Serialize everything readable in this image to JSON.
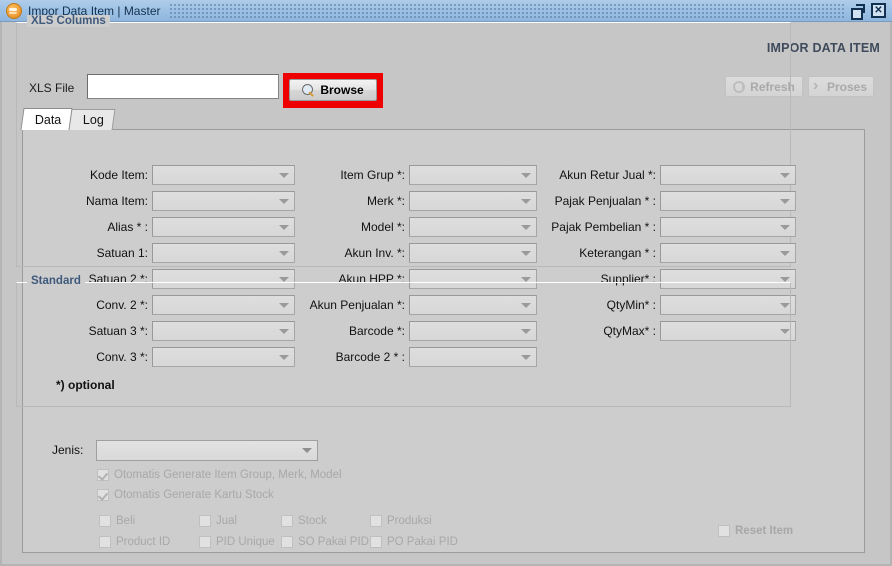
{
  "window": {
    "title": "Impor Data Item | Master",
    "app_icon": "app-logo-icon",
    "restore_label": "",
    "close_label": "✕"
  },
  "header": {
    "caption": "IMPOR DATA ITEM"
  },
  "toolbar": {
    "xls_file_label": "XLS File",
    "xls_file_value": "",
    "xls_file_placeholder": "",
    "browse_label": "Browse",
    "browse_icon": "magnifier-icon",
    "browse_highlight_color": "#ee0000",
    "refresh_label": "Refresh",
    "refresh_icon": "refresh-icon",
    "refresh_enabled": false,
    "proses_label": "Proses",
    "proses_icon": "play-icon",
    "proses_enabled": false
  },
  "tabs": [
    {
      "label": "Data",
      "active": true
    },
    {
      "label": "Log",
      "active": false
    }
  ],
  "xls_columns": {
    "title": "XLS Columns",
    "optional_note": "*) optional",
    "col1": [
      {
        "label": "Kode Item:",
        "value": ""
      },
      {
        "label": "Nama Item:",
        "value": ""
      },
      {
        "label": "Alias * :",
        "value": ""
      },
      {
        "label": "Satuan 1:",
        "value": ""
      },
      {
        "label": "Satuan 2 *:",
        "value": ""
      },
      {
        "label": "Conv. 2 *:",
        "value": ""
      },
      {
        "label": "Satuan 3 *:",
        "value": ""
      },
      {
        "label": "Conv. 3 *:",
        "value": ""
      }
    ],
    "col2": [
      {
        "label": "Item Grup *:",
        "value": ""
      },
      {
        "label": "Merk *:",
        "value": ""
      },
      {
        "label": "Model *:",
        "value": ""
      },
      {
        "label": "Akun Inv. *:",
        "value": ""
      },
      {
        "label": "Akun HPP *:",
        "value": ""
      },
      {
        "label": "Akun Penjualan *:",
        "value": ""
      },
      {
        "label": "Barcode *:",
        "value": ""
      },
      {
        "label": "Barcode 2 * :",
        "value": ""
      }
    ],
    "col3": [
      {
        "label": "Akun Retur Jual *:",
        "value": ""
      },
      {
        "label": "Pajak Penjualan * :",
        "value": ""
      },
      {
        "label": "Pajak Pembelian * :",
        "value": ""
      },
      {
        "label": "Keterangan * :",
        "value": ""
      },
      {
        "label": "Supplier* :",
        "value": ""
      },
      {
        "label": "QtyMin* :",
        "value": ""
      },
      {
        "label": "QtyMax* :",
        "value": ""
      }
    ]
  },
  "standard": {
    "title": "Standard",
    "jenis_label": "Jenis:",
    "jenis_value": "",
    "auto_checks": [
      {
        "label": "Otomatis Generate Item Group, Merk, Model",
        "checked": true,
        "enabled": false
      },
      {
        "label": "Otomatis Generate Kartu Stock",
        "checked": true,
        "enabled": false
      }
    ],
    "flag_row1": [
      {
        "label": "Beli",
        "checked": false,
        "enabled": false
      },
      {
        "label": "Jual",
        "checked": false,
        "enabled": false
      },
      {
        "label": "Stock",
        "checked": false,
        "enabled": false
      },
      {
        "label": "Produksi",
        "checked": false,
        "enabled": false
      }
    ],
    "flag_row2": [
      {
        "label": "Product ID",
        "checked": false,
        "enabled": false
      },
      {
        "label": "PID Unique",
        "checked": false,
        "enabled": false
      },
      {
        "label": "SO Pakai PID",
        "checked": false,
        "enabled": false
      },
      {
        "label": "PO Pakai PID",
        "checked": false,
        "enabled": false
      }
    ],
    "reset_item": {
      "label": "Reset Item",
      "checked": false,
      "enabled": false
    }
  }
}
